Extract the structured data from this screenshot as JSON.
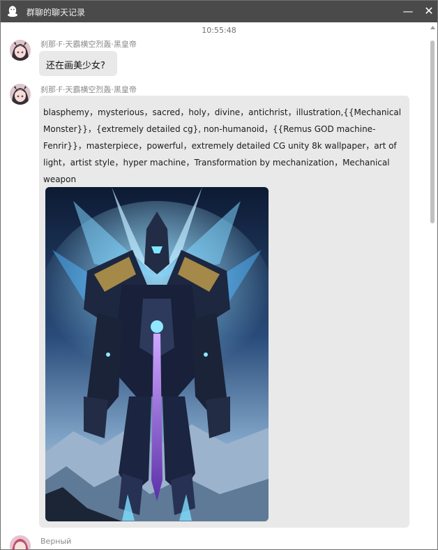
{
  "window": {
    "title": "群聊的聊天记录",
    "minimize_glyph": "—",
    "close_glyph": "✕"
  },
  "timestamp": "10:55:48",
  "messages": [
    {
      "sender": "刹那·F·天霸横空烈轰·黑皇帝",
      "text": "还在画美少女?",
      "avatar_icon": "anime-girl-avatar-icon"
    },
    {
      "sender": "刹那·F·天霸横空烈轰·黑皇帝",
      "text": "blasphemy，mysterious，sacred，holy，divine，antichrist，illustration,{{Mechanical Monster}}，{extremely detailed cg}, non-humanoid，{{Remus GOD machine-Fenrir}}，masterpiece，powerful，extremely detailed CG unity 8k wallpaper，art of light，artist style，hyper machine，Transformation by mechanization，Mechanical weapon",
      "avatar_icon": "anime-girl-avatar-icon",
      "image": "mechanical-giant-robot-illustration"
    },
    {
      "sender": "Верный",
      "avatar_icon": "anime-girl-avatar-icon"
    }
  ],
  "colors": {
    "titlebar": "#4a4a4a",
    "bubble": "#e9e9e9",
    "sender_text": "#8a8a8a",
    "scroll_thumb": "#c1c1c1"
  }
}
